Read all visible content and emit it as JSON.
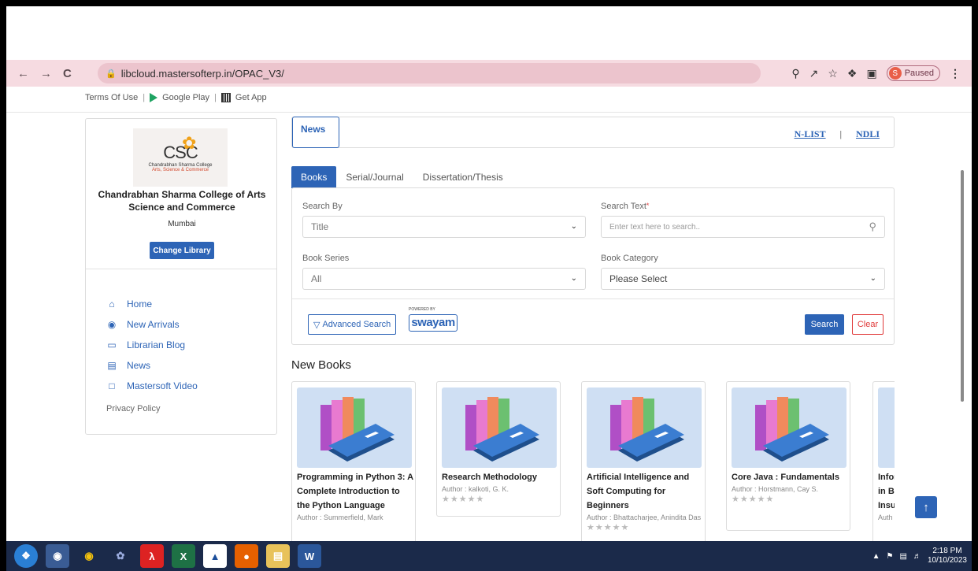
{
  "browser": {
    "url": "libcloud.mastersofterp.in/OPAC_V3/",
    "profile_initial": "S",
    "profile_status": "Paused"
  },
  "toplinks": {
    "terms": "Terms Of Use",
    "google_play": "Google Play",
    "get_app": "Get App"
  },
  "library": {
    "logo_text": "CSC",
    "logo_line1": "Chandrabhan Sharma College",
    "logo_line2": "Arts, Science & Commerce",
    "name": "Chandrabhan Sharma College of Arts Science and Commerce",
    "city": "Mumbai",
    "change_label": "Change Library"
  },
  "sidebar": {
    "items": [
      {
        "label": "Home",
        "icon": "home-icon"
      },
      {
        "label": "New Arrivals",
        "icon": "globe-icon"
      },
      {
        "label": "Librarian Blog",
        "icon": "book-icon"
      },
      {
        "label": "News",
        "icon": "document-icon"
      },
      {
        "label": "Mastersoft Video",
        "icon": "folder-icon"
      }
    ],
    "privacy": "Privacy Policy"
  },
  "newsbar": {
    "news": "News",
    "nlist": "N-LIST",
    "separator": "|",
    "ndli": "NDLI"
  },
  "tabs": [
    "Books",
    "Serial/Journal",
    "Dissertation/Thesis"
  ],
  "search": {
    "search_by_label": "Search By",
    "search_by_value": "Title",
    "search_text_label": "Search Text",
    "required_mark": "*",
    "search_text_placeholder": "Enter text here to search..",
    "book_series_label": "Book Series",
    "book_series_value": "All",
    "book_category_label": "Book Category",
    "book_category_value": "Please Select",
    "advanced_label": "Advanced Search",
    "swayam_powered": "POWERED BY",
    "swayam_label": "swayam",
    "search_button": "Search",
    "clear_button": "Clear"
  },
  "new_books_heading": "New Books",
  "books": [
    {
      "title": "Programming in Python 3: A Complete Introduction to the Python Language",
      "author": "Author : Summerfield, Mark"
    },
    {
      "title": "Research Methodology",
      "author": "Author : kalkoti, G. K."
    },
    {
      "title": "Artificial Intelligence and Soft Computing for Beginners",
      "author": "Author : Bhattacharjee, Anindita Das"
    },
    {
      "title": "Core Java : Fundamentals",
      "author": "Author : Horstmann, Cay S."
    },
    {
      "title": "Information in B Insu",
      "author": "Auth"
    }
  ],
  "taskbar": {
    "time": "2:18 PM",
    "date": "10/10/2023"
  },
  "colors": {
    "accent": "#2d64b6",
    "clear_red": "#e03a3a",
    "chrome_pink": "#f6dbe1"
  }
}
